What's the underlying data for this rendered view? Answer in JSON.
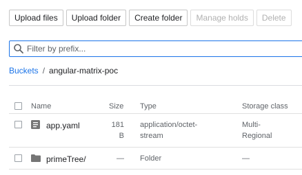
{
  "toolbar": {
    "upload_files": "Upload files",
    "upload_folder": "Upload folder",
    "create_folder": "Create folder",
    "manage_holds": "Manage holds",
    "delete": "Delete"
  },
  "filter": {
    "placeholder": "Filter by prefix..."
  },
  "breadcrumb": {
    "root": "Buckets",
    "separator": "/",
    "current": "angular-matrix-poc"
  },
  "table": {
    "headers": {
      "name": "Name",
      "size": "Size",
      "type": "Type",
      "storage_class": "Storage class"
    },
    "rows": [
      {
        "icon": "file-icon",
        "name": "app.yaml",
        "size_line1": "181",
        "size_line2": "B",
        "type_line1": "application/octet-",
        "type_line2": "stream",
        "class_line1": "Multi-",
        "class_line2": "Regional"
      },
      {
        "icon": "folder-icon",
        "name": "primeTree/",
        "size": "—",
        "type": "Folder",
        "storage_class": "—"
      }
    ]
  }
}
